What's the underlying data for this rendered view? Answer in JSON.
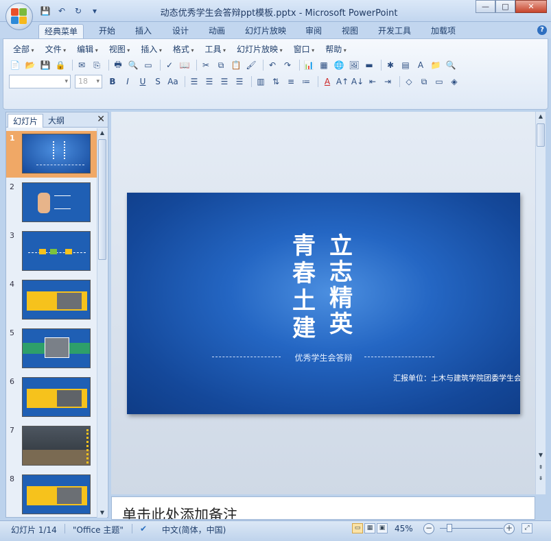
{
  "window": {
    "title": "动态优秀学生会答辩ppt模板.pptx - Microsoft PowerPoint",
    "controls": {
      "minimize": "—",
      "maximize": "□",
      "close": "✕"
    }
  },
  "quick_access": [
    {
      "name": "save-icon",
      "glyph": "💾"
    },
    {
      "name": "undo-icon",
      "glyph": "↶"
    },
    {
      "name": "redo-icon",
      "glyph": "↻"
    },
    {
      "name": "customize-icon",
      "glyph": "▾"
    }
  ],
  "tabs": [
    "经典菜单",
    "开始",
    "插入",
    "设计",
    "动画",
    "幻灯片放映",
    "审阅",
    "视图",
    "开发工具",
    "加载项"
  ],
  "active_tab": "经典菜单",
  "classic_menu": [
    "全部",
    "文件",
    "编辑",
    "视图",
    "插入",
    "格式",
    "工具",
    "幻灯片放映",
    "窗口",
    "帮助"
  ],
  "toolbar": {
    "font_name": "",
    "font_size": "18"
  },
  "left_panel": {
    "tabs": [
      "幻灯片",
      "大纲"
    ],
    "active_tab": "幻灯片",
    "close": "✕",
    "slides": [
      {
        "num": "1",
        "selected": true,
        "style": "title"
      },
      {
        "num": "2",
        "selected": false,
        "style": "fist"
      },
      {
        "num": "3",
        "selected": false,
        "style": "timeline"
      },
      {
        "num": "4",
        "selected": false,
        "style": "yellow-photo"
      },
      {
        "num": "5",
        "selected": false,
        "style": "green-photo"
      },
      {
        "num": "6",
        "selected": false,
        "style": "yellow-photo"
      },
      {
        "num": "7",
        "selected": false,
        "style": "group-photo"
      },
      {
        "num": "8",
        "selected": false,
        "style": "yellow-photo"
      }
    ]
  },
  "slide": {
    "calligraphy_right": [
      "立",
      "志",
      "精",
      "英"
    ],
    "calligraphy_left": [
      "青",
      "春",
      "土",
      "建"
    ],
    "subtitle": "优秀学生会答辩",
    "report": "汇报单位：土木与建筑学院团委学生会",
    "colors": {
      "bg_center": "#4c8fe0",
      "bg_edge": "#0f3c86"
    }
  },
  "notes": {
    "placeholder": "单击此处添加备注"
  },
  "status": {
    "slide_info": "幻灯片 1/14",
    "theme": "\"Office 主题\"",
    "language": "中文(简体，中国)",
    "zoom": "45%"
  }
}
